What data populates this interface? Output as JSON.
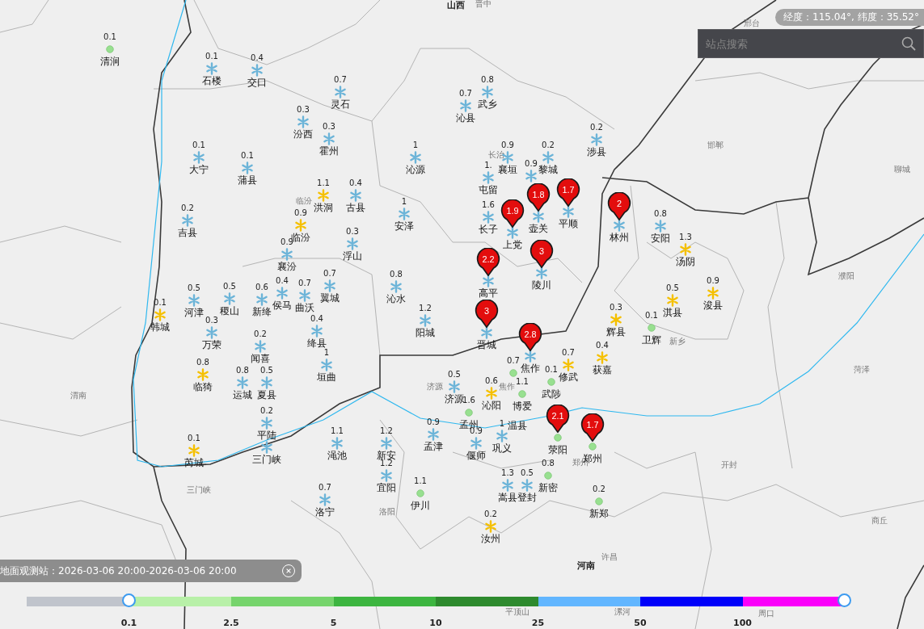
{
  "coordinates": "经度：115.04°, 纬度：35.52°",
  "search": {
    "placeholder": "站点搜索"
  },
  "regions": [
    {
      "name": "山西",
      "bold": true
    },
    {
      "name": "晋中",
      "bold": false
    },
    {
      "name": "邢台",
      "bold": false
    },
    {
      "name": "长治",
      "bold": false
    },
    {
      "name": "邯郸",
      "bold": false
    },
    {
      "name": "聊城",
      "bold": false
    },
    {
      "name": "临汾",
      "bold": false
    },
    {
      "name": "濮阳",
      "bold": false
    },
    {
      "name": "新乡",
      "bold": false
    },
    {
      "name": "菏泽",
      "bold": false
    },
    {
      "name": "渭南",
      "bold": false
    },
    {
      "name": "济源",
      "bold": false
    },
    {
      "name": "焦作",
      "bold": false
    },
    {
      "name": "郑州",
      "bold": false
    },
    {
      "name": "开封",
      "bold": false
    },
    {
      "name": "三门峡",
      "bold": false
    },
    {
      "name": "洛阳",
      "bold": false
    },
    {
      "name": "商丘",
      "bold": false
    },
    {
      "name": "河南",
      "bold": true
    },
    {
      "name": "许昌",
      "bold": false
    },
    {
      "name": "平顶山",
      "bold": false
    },
    {
      "name": "漯河",
      "bold": false
    },
    {
      "name": "周口",
      "bold": false
    }
  ],
  "stations": [
    {
      "name": "清涧",
      "value": "0.1",
      "kind": "rain",
      "pinned": false
    },
    {
      "name": "石楼",
      "value": "0.1",
      "kind": "snow",
      "pinned": false
    },
    {
      "name": "交口",
      "value": "0.4",
      "kind": "snow",
      "pinned": false
    },
    {
      "name": "灵石",
      "value": "0.7",
      "kind": "snow",
      "pinned": false
    },
    {
      "name": "武乡",
      "value": "0.8",
      "kind": "snow",
      "pinned": false
    },
    {
      "name": "沁县",
      "value": "0.7",
      "kind": "snow",
      "pinned": false
    },
    {
      "name": "汾西",
      "value": "0.3",
      "kind": "snow",
      "pinned": false
    },
    {
      "name": "霍州",
      "value": "0.3",
      "kind": "snow",
      "pinned": false
    },
    {
      "name": "涉县",
      "value": "0.2",
      "kind": "snow",
      "pinned": false
    },
    {
      "name": "大宁",
      "value": "0.1",
      "kind": "snow",
      "pinned": false
    },
    {
      "name": "沁源",
      "value": "1",
      "kind": "snow",
      "pinned": false
    },
    {
      "name": "襄垣",
      "value": "0.9",
      "kind": "snow",
      "pinned": false
    },
    {
      "name": "黎城",
      "value": "0.2",
      "kind": "snow",
      "pinned": false
    },
    {
      "name": "蒲县",
      "value": "0.1",
      "kind": "snow",
      "pinned": false
    },
    {
      "name": "屯留",
      "value": "1.",
      "kind": "snow",
      "pinned": false
    },
    {
      "value": "0.9",
      "kind": "snow",
      "pinned": false
    },
    {
      "name": "洪洞",
      "value": "1.1",
      "kind": "sleet",
      "pinned": false
    },
    {
      "name": "古县",
      "value": "0.4",
      "kind": "snow",
      "pinned": false
    },
    {
      "name": "吉县",
      "value": "0.2",
      "kind": "snow",
      "pinned": false
    },
    {
      "name": "临汾",
      "value": "0.9",
      "kind": "sleet",
      "pinned": false
    },
    {
      "name": "安泽",
      "value": "1",
      "kind": "snow",
      "pinned": false
    },
    {
      "name": "长子",
      "value": "1.6",
      "kind": "snow",
      "pinned": false
    },
    {
      "name": "上党",
      "value": "1.9",
      "kind": "snow",
      "pinned": true
    },
    {
      "name": "壶关",
      "value": "1.8",
      "kind": "snow",
      "pinned": true
    },
    {
      "name": "平顺",
      "value": "1.7",
      "kind": "snow",
      "pinned": true
    },
    {
      "name": "林州",
      "value": "2",
      "kind": "snow",
      "pinned": true
    },
    {
      "name": "安阳",
      "value": "0.8",
      "kind": "snow",
      "pinned": false
    },
    {
      "name": "襄汾",
      "value": "0.9",
      "kind": "snow",
      "pinned": false
    },
    {
      "name": "浮山",
      "value": "0.3",
      "kind": "snow",
      "pinned": false
    },
    {
      "name": "汤阴",
      "value": "1.3",
      "kind": "sleet",
      "pinned": false
    },
    {
      "name": "高平",
      "value": "2.2",
      "kind": "snow",
      "pinned": true
    },
    {
      "name": "陵川",
      "value": "3",
      "kind": "snow",
      "pinned": true
    },
    {
      "name": "河津",
      "value": "0.5",
      "kind": "snow",
      "pinned": false
    },
    {
      "name": "稷山",
      "value": "0.5",
      "kind": "snow",
      "pinned": false
    },
    {
      "name": "新绛",
      "value": "0.6",
      "kind": "snow",
      "pinned": false
    },
    {
      "name": "侯马",
      "value": "0.4",
      "kind": "snow",
      "pinned": false
    },
    {
      "name": "曲沃",
      "value": "0.7",
      "kind": "snow",
      "pinned": false
    },
    {
      "name": "翼城",
      "value": "0.7",
      "kind": "snow",
      "pinned": false
    },
    {
      "name": "沁水",
      "value": "0.8",
      "kind": "snow",
      "pinned": false
    },
    {
      "name": "淇县",
      "value": "0.5",
      "kind": "sleet",
      "pinned": false
    },
    {
      "name": "浚县",
      "value": "0.9",
      "kind": "sleet",
      "pinned": false
    },
    {
      "name": "韩城",
      "value": "0.1",
      "kind": "sleet",
      "pinned": false
    },
    {
      "name": "万荣",
      "value": "0.3",
      "kind": "snow",
      "pinned": false
    },
    {
      "name": "绛县",
      "value": "0.4",
      "kind": "snow",
      "pinned": false
    },
    {
      "name": "阳城",
      "value": "1.2",
      "kind": "snow",
      "pinned": false
    },
    {
      "name": "晋城",
      "value": "3",
      "kind": "snow",
      "pinned": true
    },
    {
      "name": "辉县",
      "value": "0.3",
      "kind": "sleet",
      "pinned": false
    },
    {
      "name": "卫辉",
      "value": "0.1",
      "kind": "rain",
      "pinned": false
    },
    {
      "name": "闻喜",
      "value": "0.2",
      "kind": "snow",
      "pinned": false
    },
    {
      "name": "垣曲",
      "value": "1",
      "kind": "snow",
      "pinned": false
    },
    {
      "name": "焦作",
      "value": "2.8",
      "kind": "snow",
      "pinned": true
    },
    {
      "name": "修武",
      "value": "0.7",
      "kind": "sleet",
      "pinned": false
    },
    {
      "name": "获嘉",
      "value": "0.4",
      "kind": "sleet",
      "pinned": false
    },
    {
      "name": "临猗",
      "value": "0.8",
      "kind": "sleet",
      "pinned": false
    },
    {
      "name": "运城",
      "value": "0.8",
      "kind": "snow",
      "pinned": false
    },
    {
      "name": "夏县",
      "value": "0.5",
      "kind": "snow",
      "pinned": false
    },
    {
      "name": "济源",
      "value": "0.5",
      "kind": "snow",
      "pinned": false
    },
    {
      "name": "沁阳",
      "value": "0.6",
      "kind": "sleet",
      "pinned": false
    },
    {
      "value": "0.7",
      "kind": "rain",
      "pinned": false
    },
    {
      "name": "博爱",
      "value": "1.1",
      "kind": "rain",
      "pinned": false
    },
    {
      "name": "武陟",
      "value": "0.1",
      "kind": "rain",
      "pinned": false
    },
    {
      "name": "平陆",
      "value": "0.2",
      "kind": "snow",
      "pinned": false
    },
    {
      "name": "孟州",
      "value": "1.6",
      "kind": "rain",
      "pinned": false
    },
    {
      "name": "温县",
      "kind": "label",
      "pinned": false
    },
    {
      "name": "芮城",
      "value": "0.1",
      "kind": "sleet",
      "pinned": false
    },
    {
      "name": "三门峡",
      "kind": "snow",
      "pinned": false
    },
    {
      "name": "渑池",
      "value": "1.1",
      "kind": "snow",
      "pinned": false
    },
    {
      "name": "新安",
      "value": "1.2",
      "kind": "snow",
      "pinned": false
    },
    {
      "name": "孟津",
      "value": "0.9",
      "kind": "snow",
      "pinned": false
    },
    {
      "name": "偃师",
      "value": "0.9",
      "kind": "snow",
      "pinned": false
    },
    {
      "name": "巩义",
      "value": "1",
      "kind": "snow",
      "pinned": false
    },
    {
      "name": "荥阳",
      "value": "2.1",
      "kind": "rain",
      "pinned": true
    },
    {
      "name": "郑州",
      "value": "1.7",
      "kind": "rain",
      "pinned": true
    },
    {
      "name": "宜阳",
      "value": "1.2",
      "kind": "snow",
      "pinned": false
    },
    {
      "name": "嵩县",
      "value": "1.3",
      "kind": "snow",
      "pinned": false
    },
    {
      "name": "登封",
      "value": "0.5",
      "kind": "snow",
      "pinned": false
    },
    {
      "name": "新密",
      "value": "0.8",
      "kind": "rain",
      "pinned": false
    },
    {
      "name": "洛宁",
      "value": "0.7",
      "kind": "snow",
      "pinned": false
    },
    {
      "name": "伊川",
      "value": "1.1",
      "kind": "rain",
      "pinned": false
    },
    {
      "name": "新郑",
      "value": "0.2",
      "kind": "rain",
      "pinned": false
    },
    {
      "name": "汝州",
      "value": "0.2",
      "kind": "sleet",
      "pinned": false
    }
  ],
  "time_range": "地面观测站：2026-03-06 20:00-2026-03-06 20:00",
  "legend": {
    "segments": [
      {
        "color": "#c0c4cc",
        "label": "0.1"
      },
      {
        "color": "#b8f0a8",
        "label": "2.5"
      },
      {
        "color": "#76d46c",
        "label": "5"
      },
      {
        "color": "#3db540",
        "label": "10"
      },
      {
        "color": "#2e8a2e",
        "label": "25"
      },
      {
        "color": "#62b6ff",
        "label": "50"
      },
      {
        "color": "#0000fa",
        "label": "100"
      },
      {
        "color": "#fa00fa"
      }
    ],
    "handles": [
      {
        "level": 0.125
      },
      {
        "level": 1
      }
    ]
  }
}
